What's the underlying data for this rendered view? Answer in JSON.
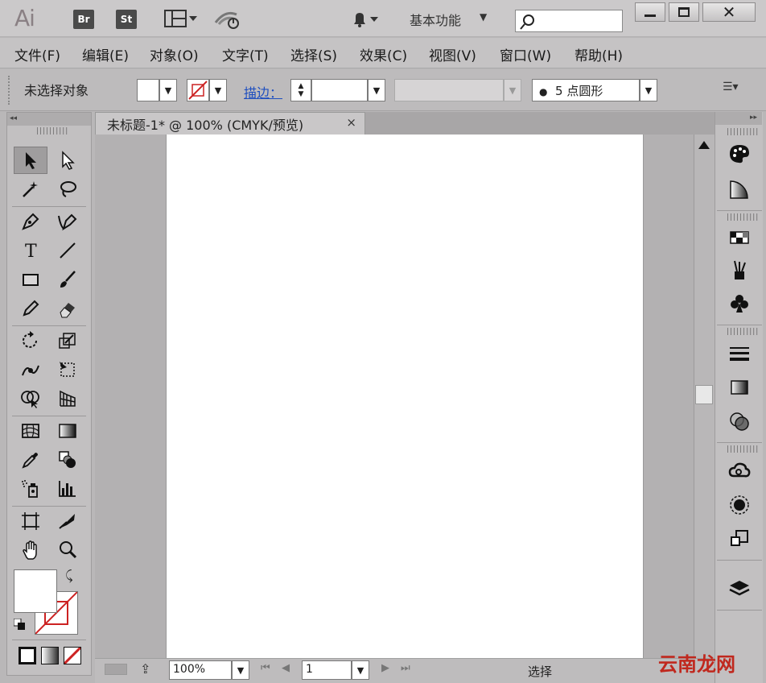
{
  "app": {
    "logo": "Ai",
    "bridge_label": "Br",
    "stock_label": "St",
    "workspace_label": "基本功能",
    "search_placeholder": ""
  },
  "menu": [
    "文件(F)",
    "编辑(E)",
    "对象(O)",
    "文字(T)",
    "选择(S)",
    "效果(C)",
    "视图(V)",
    "窗口(W)",
    "帮助(H)"
  ],
  "control_bar": {
    "selection_status": "未选择对象",
    "stroke_label": "描边：",
    "brush_value": "5 点圆形"
  },
  "document": {
    "tab_title": "未标题-1* @ 100% (CMYK/预览)",
    "close_glyph": "×"
  },
  "status_bar": {
    "zoom": "100%",
    "page": "1",
    "mode": "选择"
  },
  "watermark": "云南龙网"
}
